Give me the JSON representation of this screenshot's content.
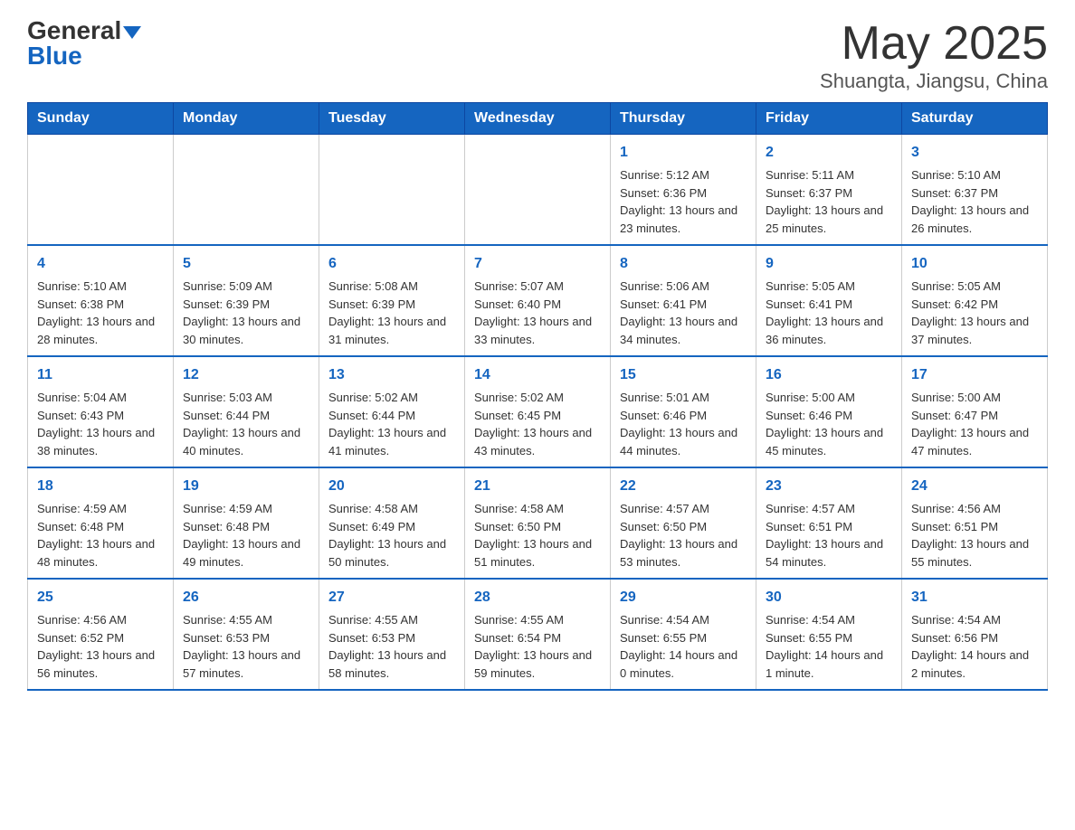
{
  "header": {
    "logo_general": "General",
    "logo_blue": "Blue",
    "title": "May 2025",
    "subtitle": "Shuangta, Jiangsu, China"
  },
  "days_of_week": [
    "Sunday",
    "Monday",
    "Tuesday",
    "Wednesday",
    "Thursday",
    "Friday",
    "Saturday"
  ],
  "weeks": [
    [
      {
        "day": "",
        "info": ""
      },
      {
        "day": "",
        "info": ""
      },
      {
        "day": "",
        "info": ""
      },
      {
        "day": "",
        "info": ""
      },
      {
        "day": "1",
        "info": "Sunrise: 5:12 AM\nSunset: 6:36 PM\nDaylight: 13 hours and 23 minutes."
      },
      {
        "day": "2",
        "info": "Sunrise: 5:11 AM\nSunset: 6:37 PM\nDaylight: 13 hours and 25 minutes."
      },
      {
        "day": "3",
        "info": "Sunrise: 5:10 AM\nSunset: 6:37 PM\nDaylight: 13 hours and 26 minutes."
      }
    ],
    [
      {
        "day": "4",
        "info": "Sunrise: 5:10 AM\nSunset: 6:38 PM\nDaylight: 13 hours and 28 minutes."
      },
      {
        "day": "5",
        "info": "Sunrise: 5:09 AM\nSunset: 6:39 PM\nDaylight: 13 hours and 30 minutes."
      },
      {
        "day": "6",
        "info": "Sunrise: 5:08 AM\nSunset: 6:39 PM\nDaylight: 13 hours and 31 minutes."
      },
      {
        "day": "7",
        "info": "Sunrise: 5:07 AM\nSunset: 6:40 PM\nDaylight: 13 hours and 33 minutes."
      },
      {
        "day": "8",
        "info": "Sunrise: 5:06 AM\nSunset: 6:41 PM\nDaylight: 13 hours and 34 minutes."
      },
      {
        "day": "9",
        "info": "Sunrise: 5:05 AM\nSunset: 6:41 PM\nDaylight: 13 hours and 36 minutes."
      },
      {
        "day": "10",
        "info": "Sunrise: 5:05 AM\nSunset: 6:42 PM\nDaylight: 13 hours and 37 minutes."
      }
    ],
    [
      {
        "day": "11",
        "info": "Sunrise: 5:04 AM\nSunset: 6:43 PM\nDaylight: 13 hours and 38 minutes."
      },
      {
        "day": "12",
        "info": "Sunrise: 5:03 AM\nSunset: 6:44 PM\nDaylight: 13 hours and 40 minutes."
      },
      {
        "day": "13",
        "info": "Sunrise: 5:02 AM\nSunset: 6:44 PM\nDaylight: 13 hours and 41 minutes."
      },
      {
        "day": "14",
        "info": "Sunrise: 5:02 AM\nSunset: 6:45 PM\nDaylight: 13 hours and 43 minutes."
      },
      {
        "day": "15",
        "info": "Sunrise: 5:01 AM\nSunset: 6:46 PM\nDaylight: 13 hours and 44 minutes."
      },
      {
        "day": "16",
        "info": "Sunrise: 5:00 AM\nSunset: 6:46 PM\nDaylight: 13 hours and 45 minutes."
      },
      {
        "day": "17",
        "info": "Sunrise: 5:00 AM\nSunset: 6:47 PM\nDaylight: 13 hours and 47 minutes."
      }
    ],
    [
      {
        "day": "18",
        "info": "Sunrise: 4:59 AM\nSunset: 6:48 PM\nDaylight: 13 hours and 48 minutes."
      },
      {
        "day": "19",
        "info": "Sunrise: 4:59 AM\nSunset: 6:48 PM\nDaylight: 13 hours and 49 minutes."
      },
      {
        "day": "20",
        "info": "Sunrise: 4:58 AM\nSunset: 6:49 PM\nDaylight: 13 hours and 50 minutes."
      },
      {
        "day": "21",
        "info": "Sunrise: 4:58 AM\nSunset: 6:50 PM\nDaylight: 13 hours and 51 minutes."
      },
      {
        "day": "22",
        "info": "Sunrise: 4:57 AM\nSunset: 6:50 PM\nDaylight: 13 hours and 53 minutes."
      },
      {
        "day": "23",
        "info": "Sunrise: 4:57 AM\nSunset: 6:51 PM\nDaylight: 13 hours and 54 minutes."
      },
      {
        "day": "24",
        "info": "Sunrise: 4:56 AM\nSunset: 6:51 PM\nDaylight: 13 hours and 55 minutes."
      }
    ],
    [
      {
        "day": "25",
        "info": "Sunrise: 4:56 AM\nSunset: 6:52 PM\nDaylight: 13 hours and 56 minutes."
      },
      {
        "day": "26",
        "info": "Sunrise: 4:55 AM\nSunset: 6:53 PM\nDaylight: 13 hours and 57 minutes."
      },
      {
        "day": "27",
        "info": "Sunrise: 4:55 AM\nSunset: 6:53 PM\nDaylight: 13 hours and 58 minutes."
      },
      {
        "day": "28",
        "info": "Sunrise: 4:55 AM\nSunset: 6:54 PM\nDaylight: 13 hours and 59 minutes."
      },
      {
        "day": "29",
        "info": "Sunrise: 4:54 AM\nSunset: 6:55 PM\nDaylight: 14 hours and 0 minutes."
      },
      {
        "day": "30",
        "info": "Sunrise: 4:54 AM\nSunset: 6:55 PM\nDaylight: 14 hours and 1 minute."
      },
      {
        "day": "31",
        "info": "Sunrise: 4:54 AM\nSunset: 6:56 PM\nDaylight: 14 hours and 2 minutes."
      }
    ]
  ]
}
